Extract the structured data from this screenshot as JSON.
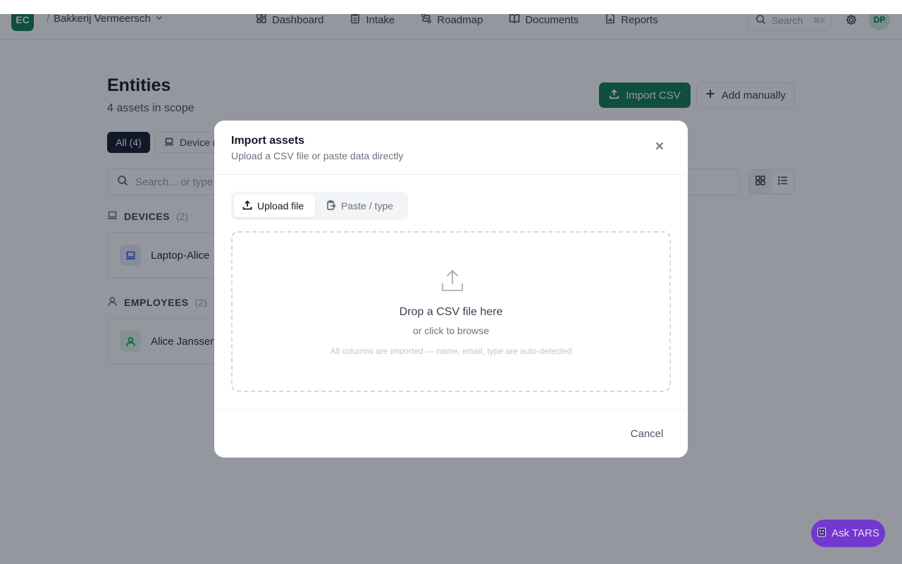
{
  "header": {
    "logo_text": "EC",
    "org_separator": "/",
    "org_name": "Bakkerij Vermeersch",
    "nav": [
      {
        "label": "Dashboard",
        "icon": "grid-icon"
      },
      {
        "label": "Intake",
        "icon": "clipboard-icon"
      },
      {
        "label": "Roadmap",
        "icon": "route-icon"
      },
      {
        "label": "Documents",
        "icon": "book-icon"
      },
      {
        "label": "Reports",
        "icon": "file-chart-icon"
      }
    ],
    "search_placeholder": "Search",
    "search_shortcut": "⌘K",
    "avatar_initials": "DP"
  },
  "page": {
    "title": "Entities",
    "subtitle": "4 assets in scope",
    "import_button": "Import CSV",
    "add_button": "Add manually",
    "filters": {
      "all": "All (4)",
      "device": "Device ("
    },
    "search_placeholder": "Search... or type t",
    "sections": [
      {
        "title": "DEVICES",
        "count": "(2)",
        "first_item": "Laptop-Alice"
      },
      {
        "title": "EMPLOYEES",
        "count": "(2)",
        "first_item": "Alice Janssen"
      }
    ]
  },
  "modal": {
    "title": "Import assets",
    "subtitle": "Upload a CSV file or paste data directly",
    "tabs": {
      "upload": "Upload file",
      "paste": "Paste / type"
    },
    "dropzone": {
      "title": "Drop a CSV file here",
      "subtitle": "or click to browse",
      "hint": "All columns are imported — name, email, type are auto-detected"
    },
    "cancel": "Cancel"
  },
  "chat": {
    "label": "Ask TARS"
  },
  "colors": {
    "brand_green": "#0f7a52",
    "chat_purple": "#6d28d9",
    "overlay": "rgba(17,24,39,0.45)"
  }
}
